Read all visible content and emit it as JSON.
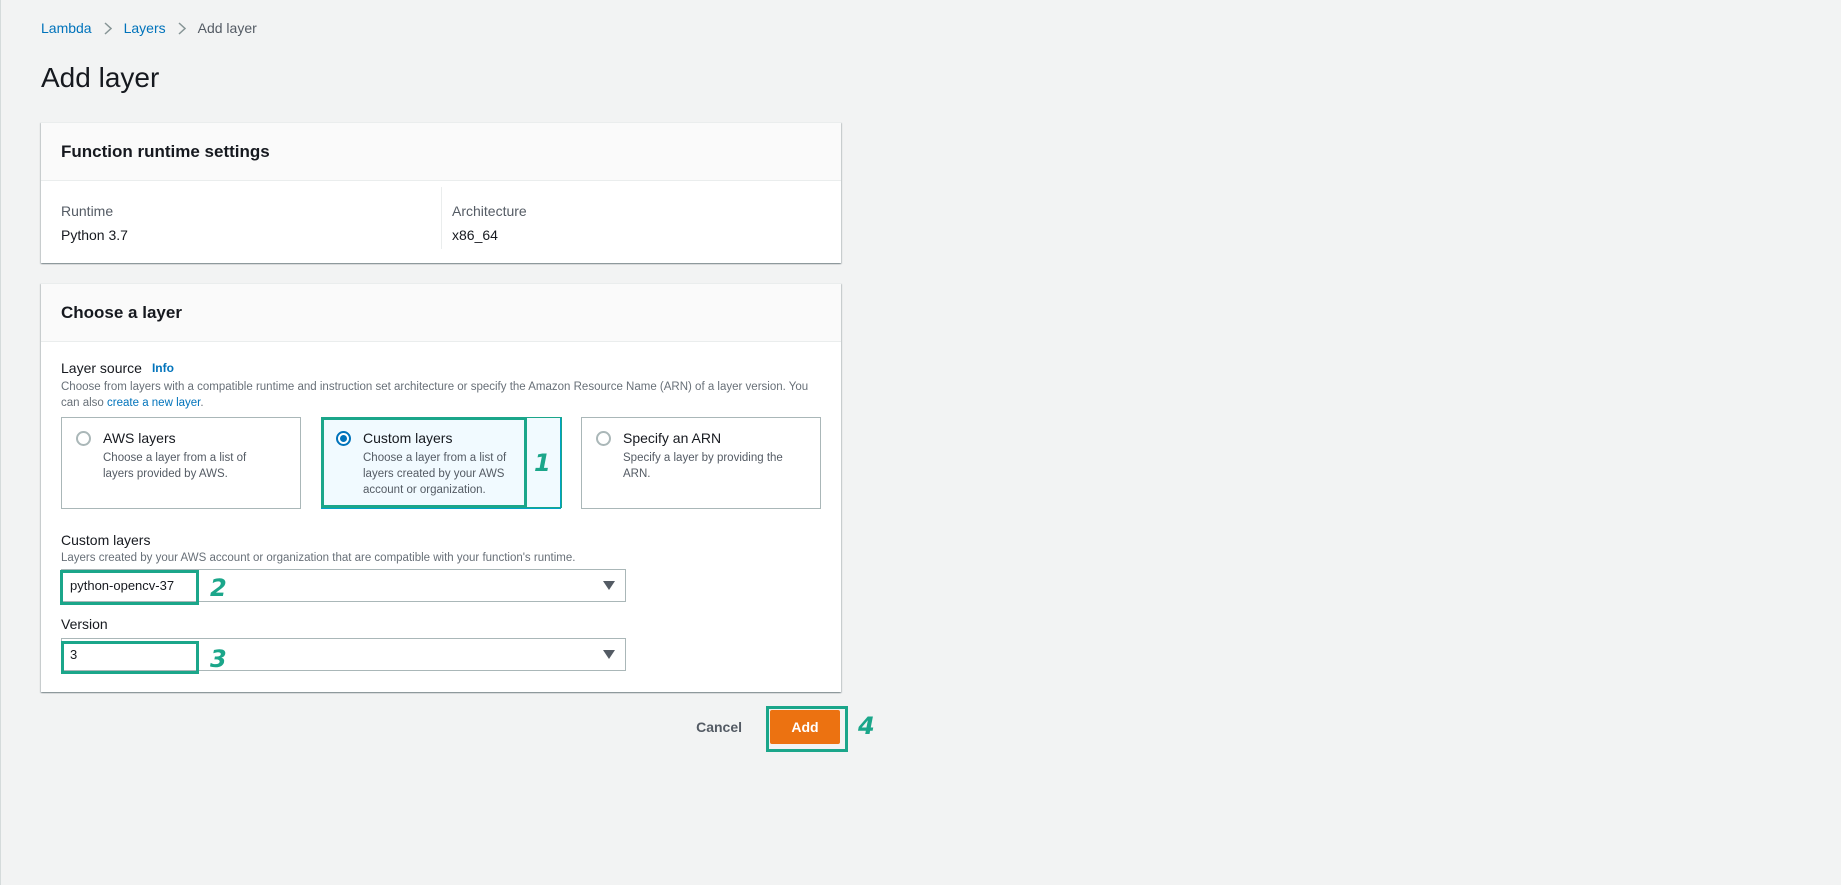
{
  "breadcrumb": [
    {
      "label": "Lambda"
    },
    {
      "label": "Layers"
    },
    {
      "label": "Add layer"
    }
  ],
  "page_title": "Add layer",
  "runtime_settings": {
    "title": "Function runtime settings",
    "runtime_label": "Runtime",
    "runtime_value": "Python 3.7",
    "architecture_label": "Architecture",
    "architecture_value": "x86_64"
  },
  "choose_layer": {
    "title": "Choose a layer",
    "layer_source_label": "Layer source",
    "info_label": "Info",
    "layer_source_desc_1": "Choose from layers with a compatible runtime and instruction set architecture or specify the Amazon Resource Name (ARN) of a layer version. You can also ",
    "layer_source_desc_link": "create a new layer",
    "layer_source_desc_2": ".",
    "options": [
      {
        "title": "AWS layers",
        "desc": "Choose a layer from a list of layers provided by AWS.",
        "selected": false
      },
      {
        "title": "Custom layers",
        "desc": "Choose a layer from a list of layers created by your AWS account or organization.",
        "selected": true
      },
      {
        "title": "Specify an ARN",
        "desc": "Specify a layer by providing the ARN.",
        "selected": false
      }
    ],
    "custom_layers_label": "Custom layers",
    "custom_layers_desc": "Layers created by your AWS account or organization that are compatible with your function's runtime.",
    "custom_layers_value": "python-opencv-37",
    "version_label": "Version",
    "version_value": "3"
  },
  "actions": {
    "cancel_label": "Cancel",
    "add_label": "Add"
  },
  "callouts": [
    "1",
    "2",
    "3",
    "4"
  ],
  "colors": {
    "link": "#0073bb",
    "primary_button": "#ec7211",
    "callout": "#1ba68a"
  }
}
